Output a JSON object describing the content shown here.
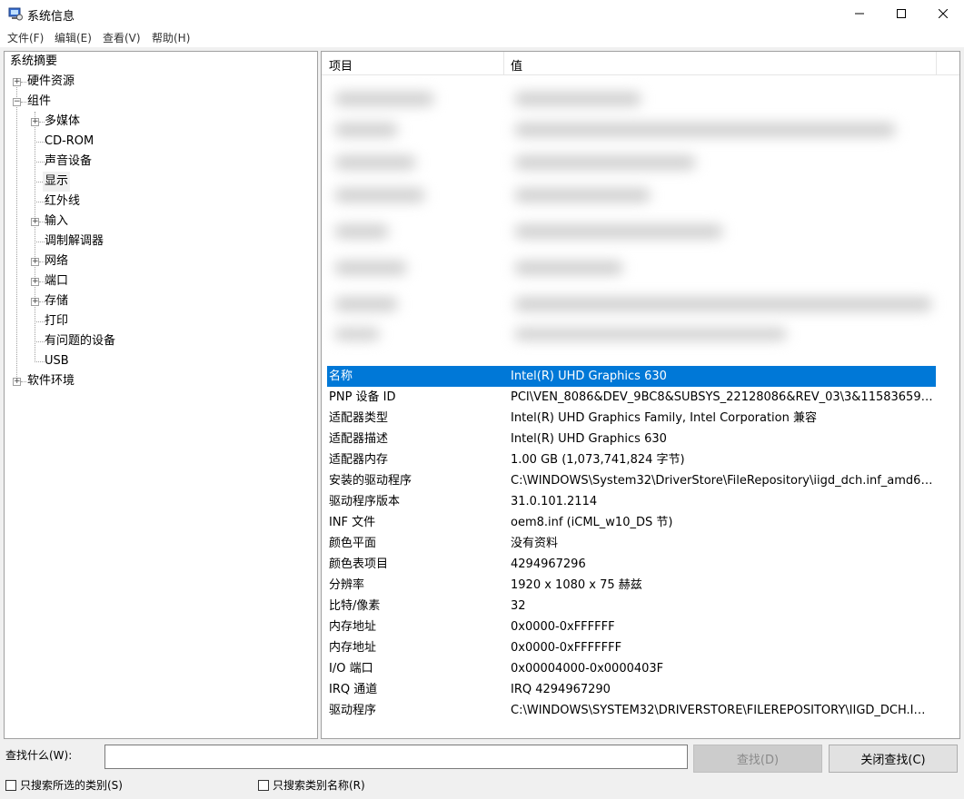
{
  "window": {
    "title": "系统信息",
    "icon": "system-info-icon"
  },
  "menu": [
    "文件(F)",
    "编辑(E)",
    "查看(V)",
    "帮助(H)"
  ],
  "tree": {
    "items": [
      {
        "label": "系统摘要",
        "expander": ""
      },
      {
        "label": "硬件资源",
        "expander": "+"
      },
      {
        "label": "组件",
        "expander": "−"
      },
      {
        "label": "多媒体",
        "expander": "+"
      },
      {
        "label": "CD-ROM",
        "expander": ""
      },
      {
        "label": "声音设备",
        "expander": ""
      },
      {
        "label": "显示",
        "expander": ""
      },
      {
        "label": "红外线",
        "expander": ""
      },
      {
        "label": "输入",
        "expander": "+"
      },
      {
        "label": "调制解调器",
        "expander": ""
      },
      {
        "label": "网络",
        "expander": "+"
      },
      {
        "label": "端口",
        "expander": "+"
      },
      {
        "label": "存储",
        "expander": "+"
      },
      {
        "label": "打印",
        "expander": ""
      },
      {
        "label": "有问题的设备",
        "expander": ""
      },
      {
        "label": "USB",
        "expander": ""
      },
      {
        "label": "软件环境",
        "expander": "+"
      }
    ]
  },
  "list": {
    "col_item": "项目",
    "col_value": "值",
    "rows": [
      {
        "item": "名称",
        "value": "Intel(R) UHD Graphics 630"
      },
      {
        "item": "PNP 设备 ID",
        "value": "PCI\\VEN_8086&DEV_9BC8&SUBSYS_22128086&REV_03\\3&11583659&..."
      },
      {
        "item": "适配器类型",
        "value": "Intel(R) UHD Graphics Family, Intel Corporation 兼容"
      },
      {
        "item": "适配器描述",
        "value": "Intel(R) UHD Graphics 630"
      },
      {
        "item": "适配器内存",
        "value": "1.00 GB (1,073,741,824 字节)"
      },
      {
        "item": "安装的驱动程序",
        "value": "C:\\WINDOWS\\System32\\DriverStore\\FileRepository\\iigd_dch.inf_amd64_..."
      },
      {
        "item": "驱动程序版本",
        "value": "31.0.101.2114"
      },
      {
        "item": "INF 文件",
        "value": "oem8.inf (iCML_w10_DS 节)"
      },
      {
        "item": "颜色平面",
        "value": "没有资料"
      },
      {
        "item": "颜色表项目",
        "value": "4294967296"
      },
      {
        "item": "分辨率",
        "value": "1920 x 1080 x 75 赫兹"
      },
      {
        "item": "比特/像素",
        "value": "32"
      },
      {
        "item": "内存地址",
        "value": "0x0000-0xFFFFFF"
      },
      {
        "item": "内存地址",
        "value": "0x0000-0xFFFFFFF"
      },
      {
        "item": "I/O 端口",
        "value": "0x00004000-0x0000403F"
      },
      {
        "item": "IRQ 通道",
        "value": "IRQ 4294967290"
      },
      {
        "item": "驱动程序",
        "value": "C:\\WINDOWS\\SYSTEM32\\DRIVERSTORE\\FILEREPOSITORY\\IIGD_DCH.INF..."
      }
    ]
  },
  "find": {
    "label": "查找什么(W):",
    "value": "",
    "find_button": "查找(D)",
    "close_button": "关闭查找(C)",
    "chk_selected_category": "只搜索所选的类别(S)",
    "chk_category_names": "只搜索类别名称(R)"
  },
  "colors": {
    "selection": "#0078d7"
  }
}
